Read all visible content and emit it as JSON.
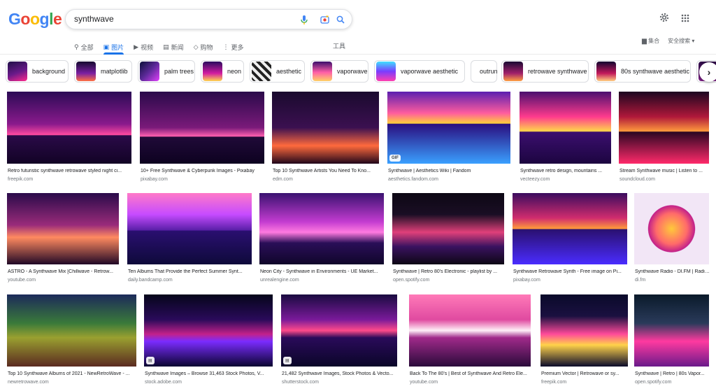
{
  "logo": {
    "letters": [
      "G",
      "o",
      "o",
      "g",
      "l",
      "e"
    ],
    "colors": [
      "#4285f4",
      "#ea4335",
      "#fbbc05",
      "#4285f4",
      "#34a853",
      "#ea4335"
    ]
  },
  "search": {
    "query": "synthwave",
    "icons": [
      "microphone-icon",
      "camera-lens-icon",
      "search-icon"
    ]
  },
  "tabs": [
    {
      "icon": "search-icon",
      "glyph": "⚲",
      "label": "全部"
    },
    {
      "icon": "image-icon",
      "glyph": "▣",
      "label": "图片",
      "active": true
    },
    {
      "icon": "video-icon",
      "glyph": "▶",
      "label": "视频"
    },
    {
      "icon": "news-icon",
      "glyph": "▤",
      "label": "新闻"
    },
    {
      "icon": "tag-icon",
      "glyph": "◇",
      "label": "购物"
    },
    {
      "icon": "more-icon",
      "glyph": "⋮",
      "label": "更多"
    }
  ],
  "tools_label": "工具",
  "right": {
    "collections": "集合",
    "safesearch": "安全搜索 ▾"
  },
  "chips": [
    {
      "label": "background",
      "thumb": "linear-gradient(160deg,#201048,#6a1a8a 55%,#ff2a8c)"
    },
    {
      "label": "matplotlib",
      "thumb": "linear-gradient(180deg,#150a30,#7b1fa2 60%,#ff7043)"
    },
    {
      "label": "palm trees",
      "thumb": "linear-gradient(135deg,#0b0f3a,#5d2a9a 50%,#e040fb)"
    },
    {
      "label": "neon",
      "thumb": "linear-gradient(180deg,#2a0a5e,#d21ba1 60%,#ffd54f)"
    },
    {
      "label": "aesthetic",
      "thumb": "repeating-linear-gradient(45deg,#222 0 4px,#eee 4px 8px)"
    },
    {
      "label": "vaporwave",
      "thumb": "linear-gradient(180deg,#3a0d6b,#ff5ea8 55%,#ffd166)"
    },
    {
      "label": "vaporwave aesthetic",
      "thumb": "linear-gradient(180deg,#40e0ff,#7a3cff 50%,#ff3fb0)"
    },
    {
      "label": "outrun"
    },
    {
      "label": "retrowave synthwave",
      "thumb": "linear-gradient(180deg,#1a0933,#a0206b 60%,#ff9f43)"
    },
    {
      "label": "80s synthwave aesthetic",
      "thumb": "linear-gradient(180deg,#120530,#c2185b 60%,#ffcc80)"
    },
    {
      "label": "",
      "thumb": "linear-gradient(180deg,#2b0a44,#7e1f86)"
    }
  ],
  "results": [
    {
      "caption": "Retro futuristic synthwave retrowave styled night ci...",
      "source": "freepik.com",
      "bg": "linear-gradient(180deg,#2b0b55 0%,#8a1a8c 45%,#ff4aa0 60%,#2a0a48 61%,#120325 100%)"
    },
    {
      "caption": "10+ Free Synthwave & Cyberpunk Images - Pixabay",
      "source": "pixabay.com",
      "bg": "linear-gradient(180deg,#2a0a4a 0%,#7a1a7a 50%,#ff5fb0 62%,#200a38 63%,#0d0220 100%)"
    },
    {
      "caption": "Top 10 Synthwave Artists You Need To Kno...",
      "source": "edm.com",
      "bg": "linear-gradient(180deg,#1a0a2e 0%,#3b1050 50%,#ff6a3d 75%,#20061a 100%)"
    },
    {
      "caption": "Synthwave | Aesthetics Wiki | Fandom",
      "source": "aesthetics.fandom.com",
      "badge": "GIF",
      "bg": "linear-gradient(180deg,#5b1fb0 0%,#ff5d9e 30%,#ffcf3a 44%,#2a0e80 45%,#3aa0ff 100%)"
    },
    {
      "caption": "Synthwave retro design, mountains ...",
      "source": "vecteezy.com",
      "bg": "linear-gradient(180deg,#4a0f6e 0%,#ff3b8d 35%,#ffd84a 55%,#3b0f6e 56%,#1c0540 100%)"
    },
    {
      "caption": "Stream Synthwave music | Listen to ...",
      "source": "soundcloud.com",
      "bg": "linear-gradient(180deg,#1b0620 0%,#b0183a 35%,#ff9a3c 55%,#2a0622 56%,#ff2a6a 100%)"
    },
    {
      "caption": "ASTRO - A Synthwave Mix [Chillwave - Retrow...",
      "source": "youtube.com",
      "bg": "linear-gradient(180deg,#2a0b4a 0%,#9a2b7a 45%,#ff8a60 62%,#200826 100%)"
    },
    {
      "caption": "Ten Albums That Provide the Perfect Summer Synt...",
      "source": "daily.bandcamp.com",
      "bg": "linear-gradient(180deg,#ff7ac8 0%,#c64bff 30%,#5a1fa8 52%,#2a0f70 53%,#0e0a3a 100%)"
    },
    {
      "caption": "Neon City - Synthwave in Environments - UE Market...",
      "source": "unrealengine.com",
      "bg": "linear-gradient(180deg,#3a1270 0%,#c23bd0 40%,#ff7ae0 55%,#2a0e58 70%,#10062a 100%)"
    },
    {
      "caption": "Synthwave | Retro 80's Electronic - playlist by ...",
      "source": "open.spotify.com",
      "bg": "linear-gradient(180deg,#0d0714 0%,#1a0e24 30%,#e0407a 55%,#3a1260 75%,#0d0714 100%)"
    },
    {
      "caption": "Synthwave Retrowave Synth - Free image on Pi...",
      "source": "pixabay.com",
      "bg": "linear-gradient(180deg,#3a0c5e 0%,#d02c6e 35%,#ff9b3a 50%,#2a1070 51%,#4a2cff 100%)"
    },
    {
      "caption": "Synthwave Radio - DI.FM | Radio ...",
      "source": "di.fm",
      "bg": "radial-gradient(circle at 50% 50%,#ffc93a 0%,#ff6a6a 30%,#c2218a 45%,#f2e6f6 46%)"
    },
    {
      "caption": "Top 10 Synthwave Albums of 2021 - NewRetroWave - ...",
      "source": "newretrowave.com",
      "bg": "linear-gradient(180deg,#1c2a5a 0%,#3a7a3a 40%,#9aa030 60%,#5a2a20 100%)"
    },
    {
      "caption": "Synthwave Images – Browse 31,463 Stock Photos, V...",
      "source": "stock.adobe.com",
      "badge": "▤",
      "bg": "linear-gradient(180deg,#05061a 0%,#2a0a5a 35%,#c2218a 55%,#7b2cff 65%,#0a0530 100%)"
    },
    {
      "caption": "21,482 Synthwave Images, Stock Photos & Vecto...",
      "source": "shutterstock.com",
      "badge": "▤",
      "bg": "linear-gradient(180deg,#1a0b40 0%,#7a1a9a 35%,#ff4a8a 50%,#2a0a5a 60%,#0a0628 100%)"
    },
    {
      "caption": "Back To The 80's | Best of Synthwave And Retro Ele...",
      "source": "youtube.com",
      "bg": "linear-gradient(180deg,#ff7ab8 0%,#e04aa0 35%,#fff0f8 50%,#a02a8a 60%,#2a0a3a 100%)"
    },
    {
      "caption": "Premium Vector | Retrowave or sy...",
      "source": "freepik.com",
      "bg": "linear-gradient(180deg,#0a0a2a 0%,#1a1040 30%,#ff4a9a 55%,#ffd24a 70%,#0a0a2a 100%)"
    },
    {
      "caption": "Synthwave | Retro | 80s Vapor...",
      "source": "open.spotify.com",
      "bg": "linear-gradient(180deg,#0a1a2a 0%,#2a3a5a 40%,#ff3aa0 65%,#6a1a8a 100%)"
    }
  ]
}
